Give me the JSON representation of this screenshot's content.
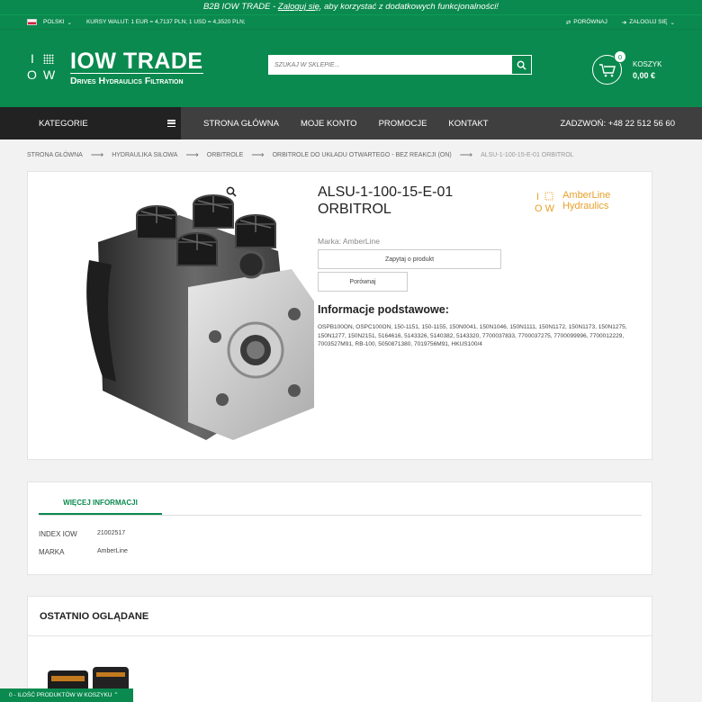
{
  "banner": {
    "prefix": "B2B IOW TRADE - ",
    "link": "Zaloguj się",
    "suffix": ", aby korzystać z dodatkowych funkcjonalności!"
  },
  "util": {
    "lang": "POLSKI",
    "rates": "KURSY WALUT: 1 EUR = 4,7137 PLN; 1 USD = 4,3520 PLN;",
    "compare": "PORÓWNAJ",
    "login": "ZALOGUJ SIĘ"
  },
  "logo": {
    "i": "I",
    "o": "O",
    "w": "W",
    "name": "IOW TRADE",
    "tagline": "Drives Hydraulics Filtration"
  },
  "search": {
    "placeholder": "SZUKAJ W SKLEPIE..."
  },
  "cart": {
    "count": "0",
    "label": "KOSZYK",
    "amount": "0,00 €"
  },
  "nav": {
    "categories": "KATEGORIE",
    "items": [
      "STRONA GŁÓWNA",
      "MOJE KONTO",
      "PROMOCJE",
      "KONTAKT"
    ],
    "phone": "ZADZWOŃ: +48 22 512 56 60"
  },
  "breadcrumb": [
    "STRONA GŁÓWNA",
    "HYDRAULIKA SIŁOWA",
    "ORBITROLE",
    "ORBITROLE DO UKŁADU OTWARTEGO - BEZ REAKCJI (ON)",
    "ALSU-1-100-15-E-01 ORBITROL"
  ],
  "product": {
    "title": "ALSU-1-100-15-E-01 ORBITROL",
    "brand_label": "Marka:",
    "brand": "AmberLine",
    "ask_button": "Zapytaj o produkt",
    "compare_button": "Porównaj",
    "info_heading": "Informacje podstawowe:",
    "info_text": "OSPB100ON, OSPC100ON, 150-1151, 150-1155, 150N0041, 150N1046, 150N1111, 150N1172, 150N1173, 150N1275, 150N1277, 150N2151, 5164616, 5143326, 5140382, 5143320, 7700037833, 7700037275, 7700099996, 7700012229, 7003527M91, RB-100, 5050871380, 7019756M91, HKUS100/4",
    "brand_logo": {
      "line1": "AmberLine",
      "line2": "Hydraulics"
    }
  },
  "more_info": {
    "tab": "WIĘCEJ INFORMACJI",
    "rows": [
      {
        "label": "INDEX IOW",
        "value": "21002517"
      },
      {
        "label": "MARKA",
        "value": "AmberLine"
      }
    ]
  },
  "recent": {
    "heading": "OSTATNIO OGLĄDANE"
  },
  "cartbar": {
    "text": "0 - ILOŚĆ PRODUKTÓW W KOSZYKU"
  },
  "colors": {
    "brand_green": "#0a8a4e",
    "nav_dark": "#3f3f3f",
    "accent_orange": "#e8a02a"
  }
}
